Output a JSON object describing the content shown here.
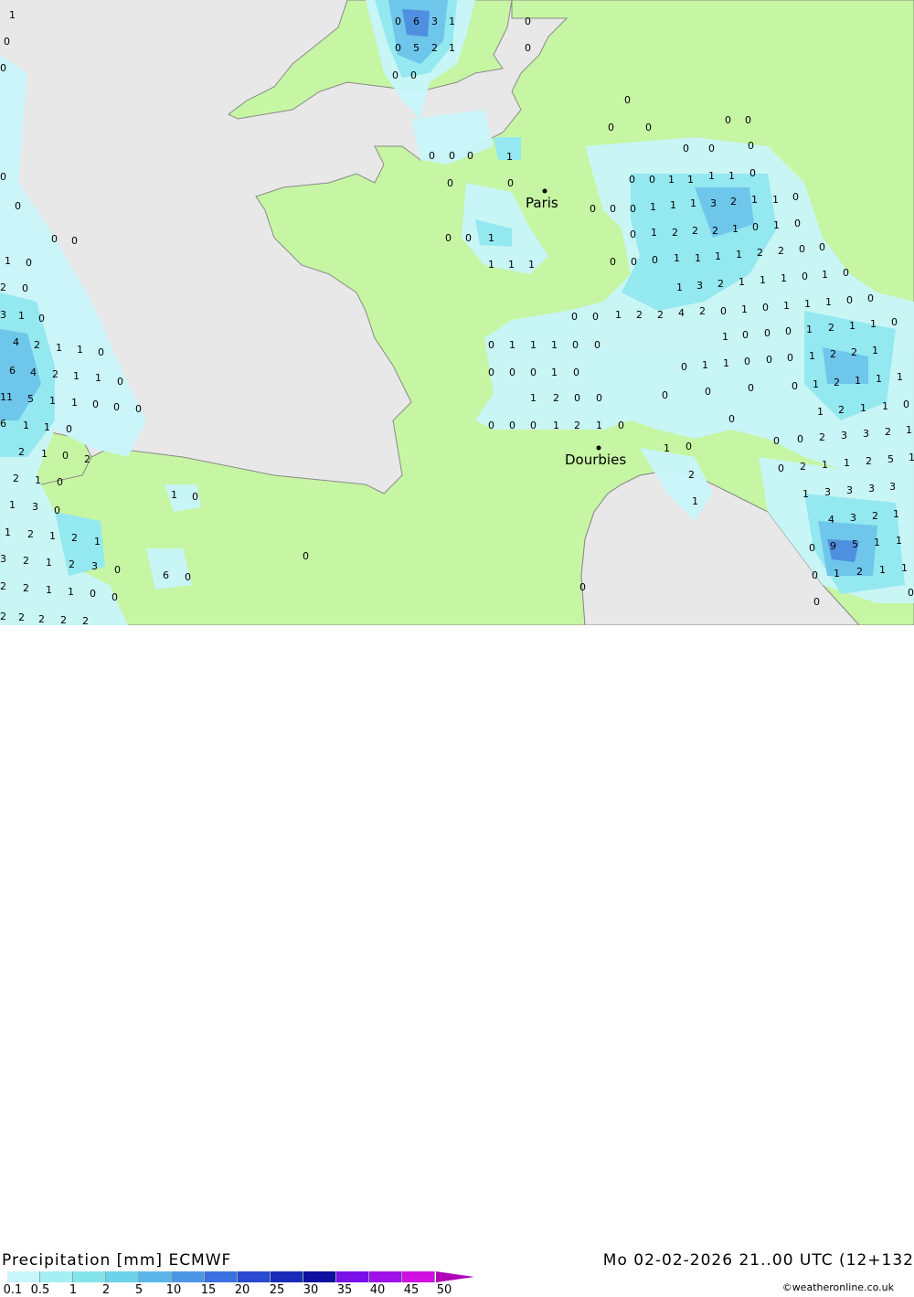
{
  "map": {
    "colors": {
      "sea": "#e8e8e8",
      "land": "#c6f5a3",
      "border": "#8a8a8a",
      "precip_light": "#c9f6fa",
      "precip_mid": "#94e8f0",
      "precip_heavy": "#6ec6ea",
      "precip_max": "#4f8fe0"
    },
    "cities": [
      {
        "name": "Paris"
      },
      {
        "name": "Dourbies"
      }
    ]
  },
  "header": {
    "title": "Precipitation [mm] ECMWF",
    "datetime": "Mo 02-02-2026 21..00 UTC (12+132"
  },
  "legend": {
    "ticks": [
      "0.1",
      "0.5",
      "1",
      "2",
      "5",
      "10",
      "15",
      "20",
      "25",
      "30",
      "35",
      "40",
      "45",
      "50"
    ],
    "colors": [
      "#c9f6fa",
      "#a5eef4",
      "#84e4ec",
      "#6cd2e8",
      "#5bb5e8",
      "#4c96e4",
      "#3a70e0",
      "#2a48d0",
      "#1a2ab8",
      "#1010a0",
      "#7a10e8",
      "#a010e8",
      "#d010e0",
      "#e010c8"
    ],
    "credit": "©weatheronline.co.uk"
  }
}
